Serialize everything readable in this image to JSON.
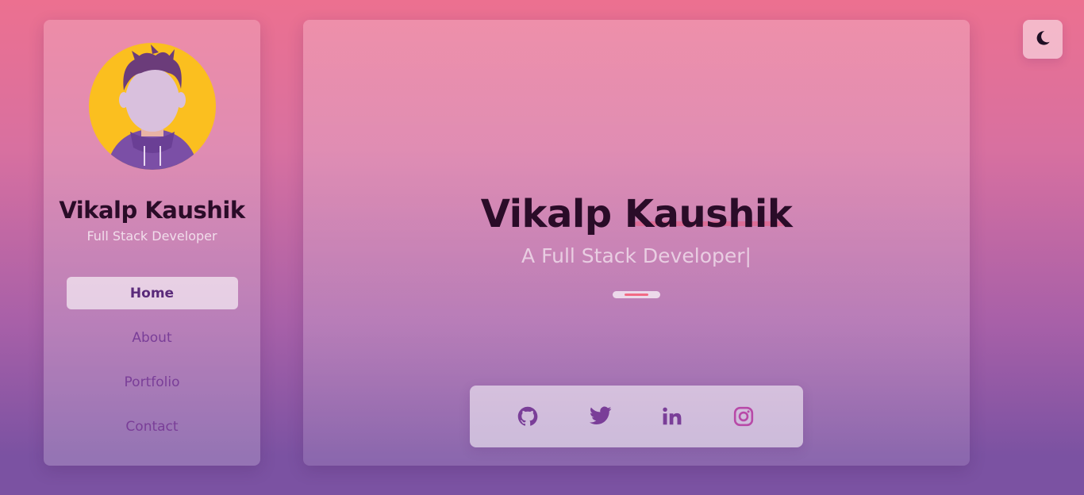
{
  "profile": {
    "name": "Vikalp Kaushik",
    "role": "Full Stack Developer"
  },
  "nav": {
    "items": [
      {
        "label": "Home"
      },
      {
        "label": "About"
      },
      {
        "label": "Portfolio"
      },
      {
        "label": "Contact"
      }
    ],
    "active_index": 0
  },
  "hero": {
    "title": "Vikalp Kaushik",
    "subtitle": "A Full Stack Developer",
    "cursor": "|"
  },
  "social": {
    "icons": [
      "github-icon",
      "twitter-icon",
      "linkedin-icon",
      "instagram-icon"
    ]
  },
  "theme_toggle": {
    "icon": "moon-icon"
  },
  "colors": {
    "accent": "#7a3e98",
    "avatar_bg": "#fbbf1f",
    "highlight": "#f26b85",
    "instagram": "#b84aa8"
  }
}
